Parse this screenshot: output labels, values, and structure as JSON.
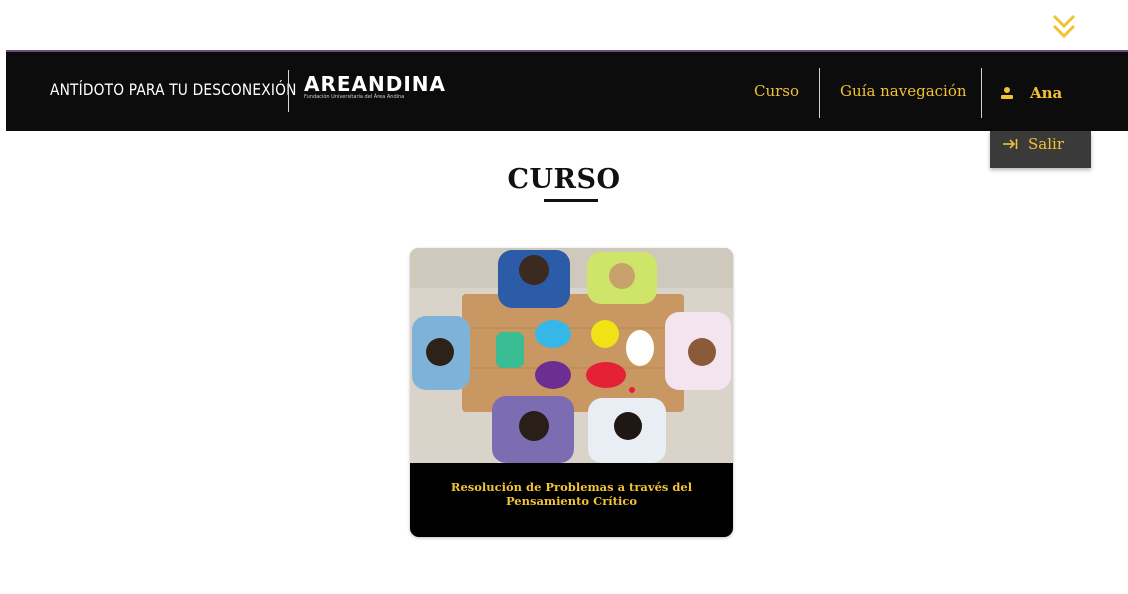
{
  "header": {
    "tagline": "ANTÍDOTO PARA TU DESCONEXIÓN",
    "logo": {
      "name": "AREANDINA",
      "subtitle": "Fundación Universitaria del Área Andina"
    },
    "nav": [
      {
        "label": "Curso",
        "icon": null
      },
      {
        "label": "Guía navegación",
        "icon": null
      }
    ],
    "user": {
      "name": "Ana",
      "icon": "user-icon"
    },
    "accent_color": "#f1c232",
    "background_color": "#0c0c0c"
  },
  "user_dropdown": {
    "items": [
      {
        "label": "Salir",
        "icon": "logout-icon"
      }
    ]
  },
  "scroll_indicator": {
    "icon": "double-chevron-down-icon"
  },
  "main": {
    "title": "CURSO",
    "courses": [
      {
        "title": "Resolución de Problemas a través del Pensamiento Crítico",
        "image": "people-around-table-with-speech-bubbles"
      }
    ]
  }
}
